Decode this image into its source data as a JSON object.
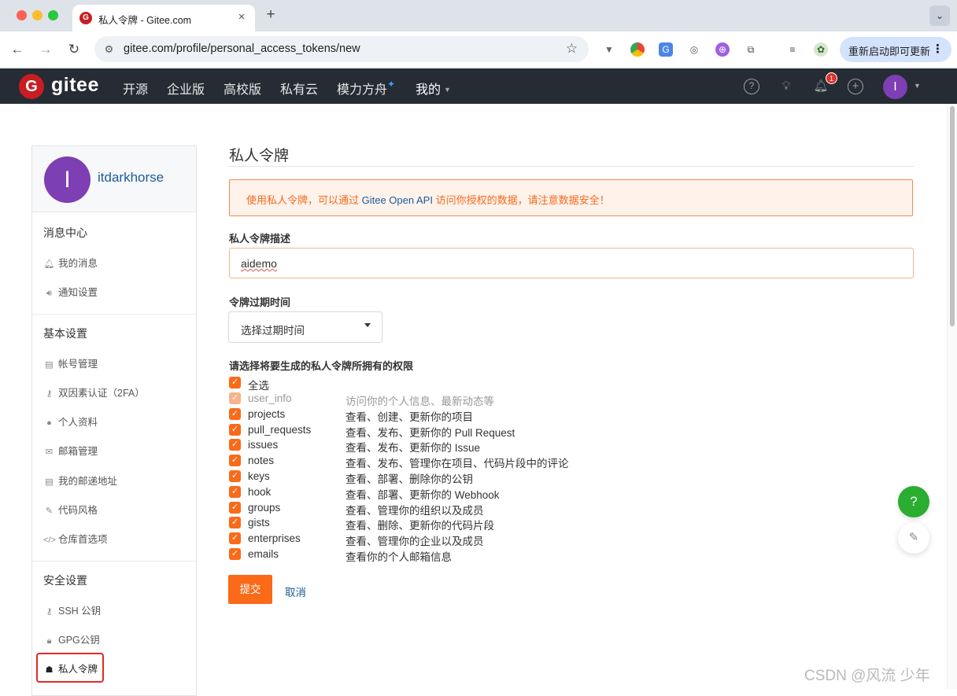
{
  "browser": {
    "tab_title": "私人令牌 - Gitee.com",
    "favicon_letter": "G",
    "url": "gitee.com/profile/personal_access_tokens/new",
    "update_button": "重新启动即可更新"
  },
  "header": {
    "logo_letter": "G",
    "logo_text": "gitee",
    "nav": [
      "开源",
      "企业版",
      "高校版",
      "私有云",
      "模力方舟",
      "我的"
    ],
    "sparkle": "✦",
    "notification_count": "1",
    "avatar_letter": "I"
  },
  "sidebar": {
    "user": {
      "avatar_letter": "I",
      "name": "itdarkhorse"
    },
    "sections": [
      {
        "heading": "消息中心",
        "items": [
          {
            "icon": "bell-icon",
            "label": "我的消息"
          },
          {
            "icon": "speaker-icon",
            "label": "通知设置"
          }
        ]
      },
      {
        "heading": "基本设置",
        "items": [
          {
            "icon": "id-card-icon",
            "label": "帐号管理"
          },
          {
            "icon": "user-key-icon",
            "label": "双因素认证（2FA）"
          },
          {
            "icon": "user-icon",
            "label": "个人资料"
          },
          {
            "icon": "envelope-icon",
            "label": "邮箱管理"
          },
          {
            "icon": "address-card-icon",
            "label": "我的邮递地址"
          },
          {
            "icon": "brush-icon",
            "label": "代码风格"
          },
          {
            "icon": "code-icon",
            "label": "仓库首选项"
          }
        ]
      },
      {
        "heading": "安全设置",
        "items": [
          {
            "icon": "key-icon",
            "label": "SSH 公钥"
          },
          {
            "icon": "lock-icon",
            "label": "GPG公钥"
          },
          {
            "icon": "user-secret-icon",
            "label": "私人令牌"
          }
        ]
      }
    ]
  },
  "main": {
    "title": "私人令牌",
    "notice_before": "使用私人令牌，可以通过 ",
    "notice_link": "Gitee Open API",
    "notice_after": " 访问你授权的数据，请注意数据安全！",
    "description_label": "私人令牌描述",
    "description_value": "aidemo",
    "expiry_label": "令牌过期时间",
    "expiry_selected": "选择过期时间",
    "permissions_label": "请选择将要生成的私人令牌所拥有的权限",
    "select_all_label": "全选",
    "permissions": [
      {
        "name": "user_info",
        "desc": "访问你的个人信息、最新动态等",
        "checked": true,
        "disabled": true
      },
      {
        "name": "projects",
        "desc": "查看、创建、更新你的项目",
        "checked": true,
        "disabled": false
      },
      {
        "name": "pull_requests",
        "desc": "查看、发布、更新你的 Pull Request",
        "checked": true,
        "disabled": false
      },
      {
        "name": "issues",
        "desc": "查看、发布、更新你的 Issue",
        "checked": true,
        "disabled": false
      },
      {
        "name": "notes",
        "desc": "查看、发布、管理你在项目、代码片段中的评论",
        "checked": true,
        "disabled": false
      },
      {
        "name": "keys",
        "desc": "查看、部署、删除你的公钥",
        "checked": true,
        "disabled": false
      },
      {
        "name": "hook",
        "desc": "查看、部署、更新你的 Webhook",
        "checked": true,
        "disabled": false
      },
      {
        "name": "groups",
        "desc": "查看、管理你的组织以及成员",
        "checked": true,
        "disabled": false
      },
      {
        "name": "gists",
        "desc": "查看、删除、更新你的代码片段",
        "checked": true,
        "disabled": false
      },
      {
        "name": "enterprises",
        "desc": "查看、管理你的企业以及成员",
        "checked": true,
        "disabled": false
      },
      {
        "name": "emails",
        "desc": "查看你的个人邮箱信息",
        "checked": true,
        "disabled": false
      }
    ],
    "submit_label": "提交",
    "cancel_label": "取消"
  },
  "float": {
    "help": "?"
  },
  "watermark": "CSDN @风流 少年",
  "colors": {
    "accent": "#fa6a18",
    "header_bg": "#252c33",
    "link": "#1b5c9b",
    "brand": "#c71d23"
  }
}
